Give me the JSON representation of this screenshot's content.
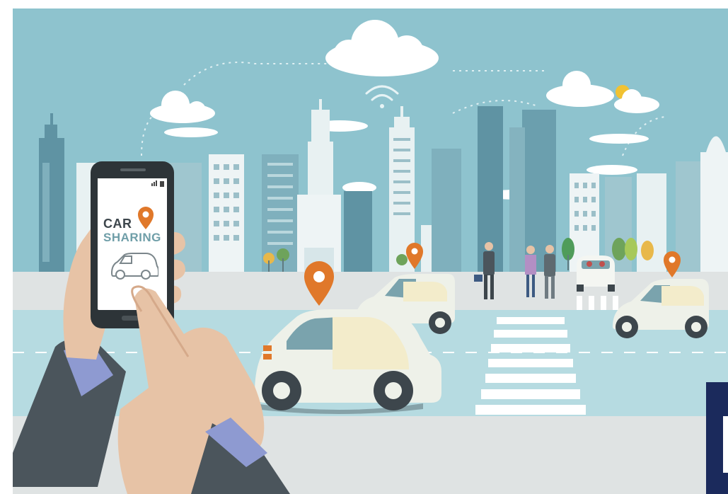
{
  "illustration": {
    "subject": "car-sharing",
    "phone_app": {
      "title_line1": "CAR",
      "title_line2": "SHARING",
      "icons": [
        "location-pin-icon",
        "car-icon",
        "signal-icon",
        "battery-icon"
      ]
    },
    "scene_icons": [
      "wifi-signal-icon",
      "sun-icon",
      "location-pin-icon",
      "crosswalk"
    ],
    "colors": {
      "sky": "#8ec3ce",
      "road": "#b6dbe1",
      "pin": "#e0782a",
      "car_body": "#eef1e9",
      "car_accent": "#7aa3ad",
      "building_dark": "#5f93a3",
      "building_light": "#e8f1f2",
      "sleeve": "#4b555c"
    }
  }
}
